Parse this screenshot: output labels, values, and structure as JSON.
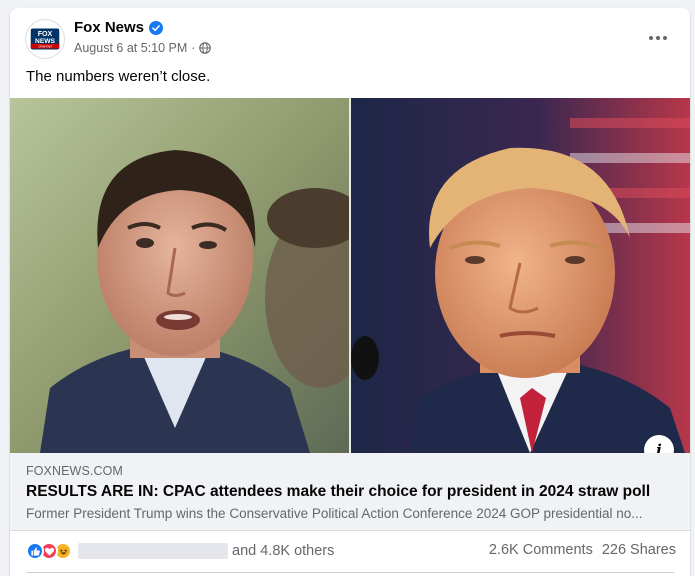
{
  "post": {
    "page_name": "Fox News",
    "avatar_text_top": "FOX",
    "avatar_text_mid": "NEWS",
    "avatar_text_bottom": "channel",
    "timestamp": "August 6 at 5:10 PM",
    "separator": "·",
    "audience_icon": "globe-icon",
    "caption": "The numbers weren’t close."
  },
  "link": {
    "domain": "FOXNEWS.COM",
    "title": "RESULTS ARE IN: CPAC attendees make their choice for president in 2024 straw poll",
    "description": "Former President Trump wins the Conservative Political Action Conference 2024 GOP presidential no..."
  },
  "engagement": {
    "reaction_icons": [
      "like-icon",
      "love-icon",
      "haha-icon"
    ],
    "others_text": "and 4.8K others",
    "comments": "2.6K Comments",
    "shares": "226 Shares"
  },
  "colors": {
    "brand_blue": "#1877f2",
    "fox_navy": "#003366",
    "fox_red": "#cc0000",
    "secondary_text": "#65676b"
  }
}
